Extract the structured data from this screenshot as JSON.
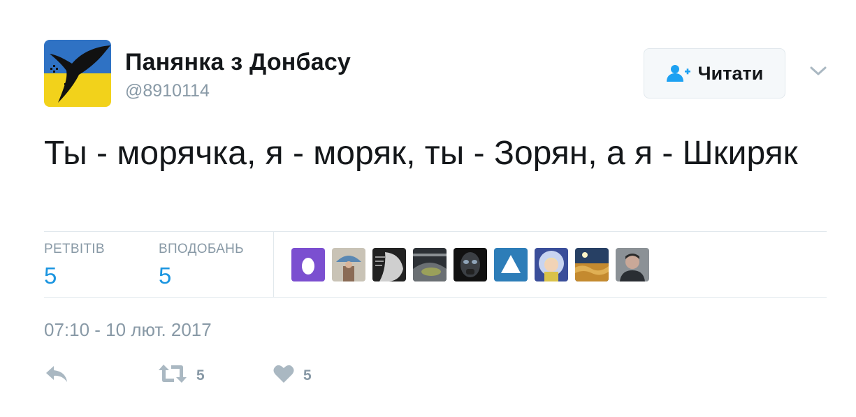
{
  "user": {
    "display_name": "Панянка з Донбасу",
    "handle": "@8910114",
    "avatar_icon": "swallow-flag-icon"
  },
  "follow_button": {
    "label": "Читати",
    "icon": "follow-user-plus-icon"
  },
  "tweet": {
    "text": "Ты - морячка, я - моряк, ты - Зорян, а я - Шкиряк"
  },
  "stats": {
    "retweets_label": "РЕТВІТІВ",
    "retweets_count": "5",
    "likes_label": "ВПОДОБАНЬ",
    "likes_count": "5"
  },
  "likers": [
    {
      "name": "egg-avatar",
      "bg": "#7b4fd0"
    },
    {
      "name": "umbrella-photo-avatar",
      "bg": "#9aa7b3"
    },
    {
      "name": "bw-portrait-avatar",
      "bg": "#444444"
    },
    {
      "name": "stadium-avatar",
      "bg": "#3b3f43"
    },
    {
      "name": "dark-mask-avatar",
      "bg": "#1b1d20"
    },
    {
      "name": "triangle-logo-avatar",
      "bg": "#2d7db8"
    },
    {
      "name": "child-light-avatar",
      "bg": "#5b6fb8"
    },
    {
      "name": "wheat-field-avatar",
      "bg": "#c48a2f"
    },
    {
      "name": "man-portrait-avatar",
      "bg": "#5e6468"
    }
  ],
  "timestamp": "07:10 - 10 лют. 2017",
  "actions": {
    "reply_icon": "reply-icon",
    "retweet_icon": "retweet-icon",
    "retweet_count": "5",
    "like_icon": "heart-icon",
    "like_count": "5"
  },
  "colors": {
    "accent": "#1b95e0",
    "muted": "#8899a6",
    "text": "#14171a",
    "border": "#e1e8ed",
    "follow_icon": "#1da1f2"
  }
}
